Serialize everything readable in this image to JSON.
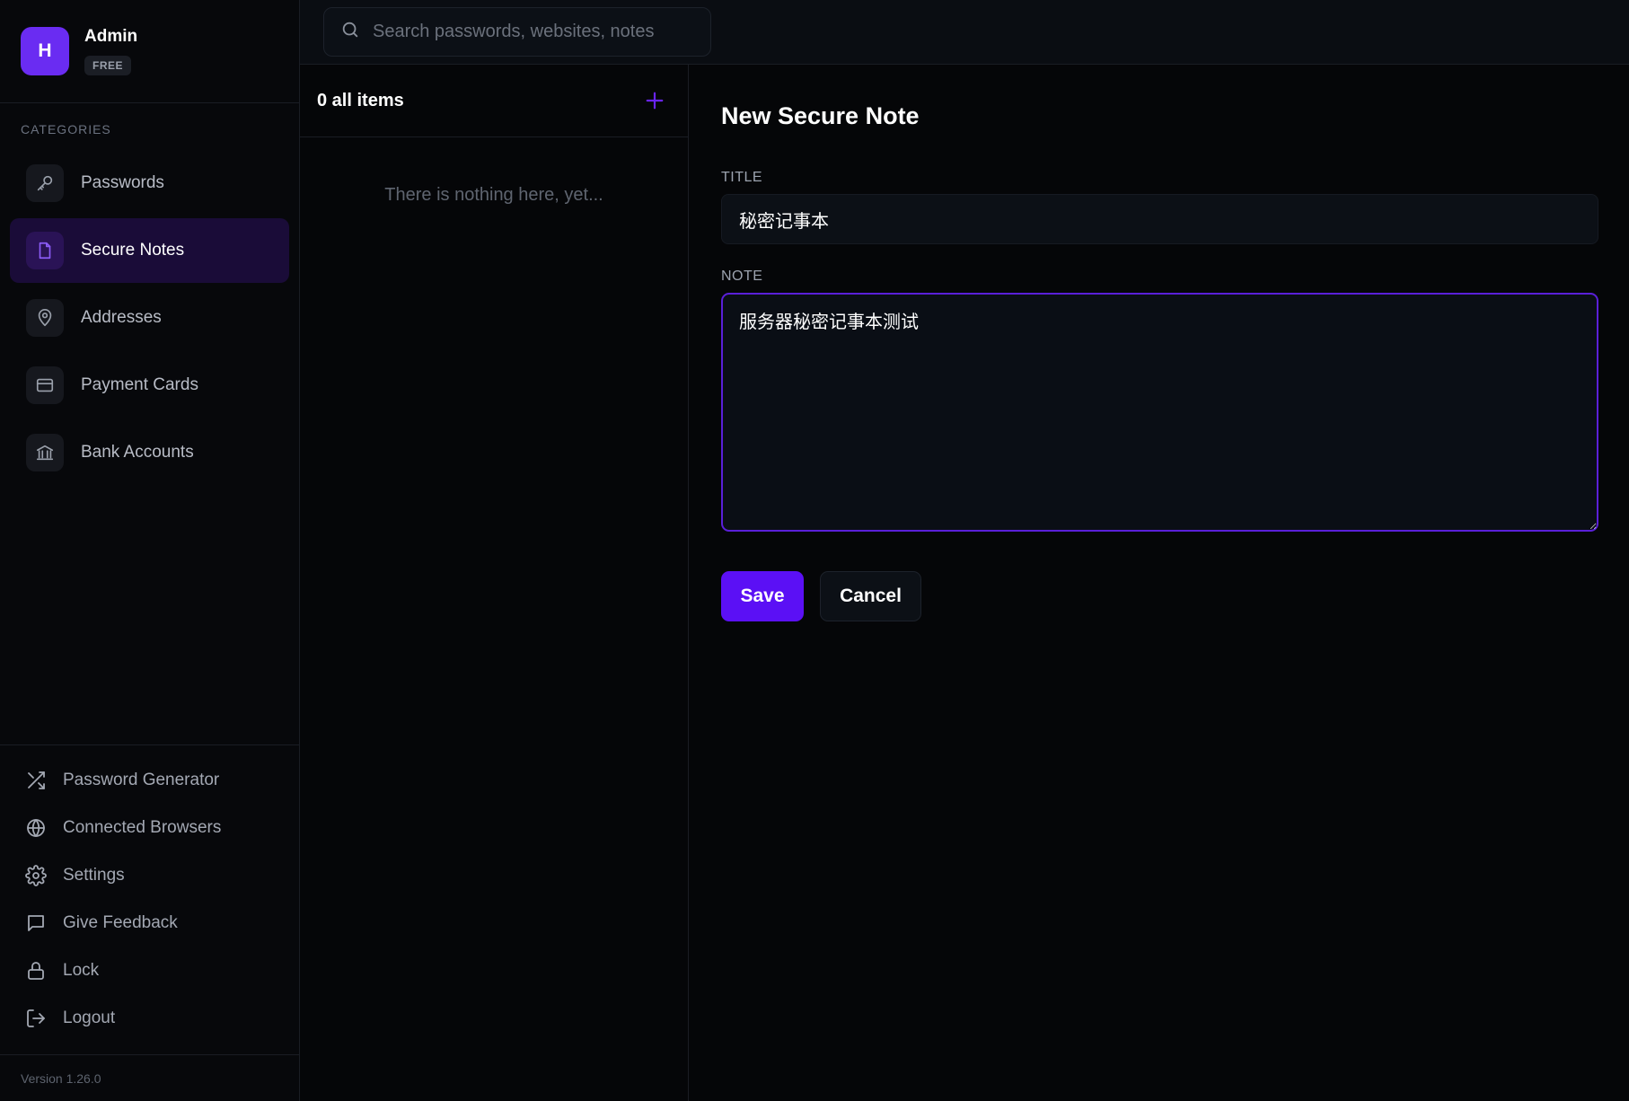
{
  "profile": {
    "avatar_letter": "H",
    "name": "Admin",
    "plan": "FREE"
  },
  "categories": {
    "title": "CATEGORIES",
    "items": [
      {
        "label": "Passwords",
        "icon": "key-icon",
        "active": false
      },
      {
        "label": "Secure Notes",
        "icon": "note-icon",
        "active": true
      },
      {
        "label": "Addresses",
        "icon": "location-pin-icon",
        "active": false
      },
      {
        "label": "Payment Cards",
        "icon": "credit-card-icon",
        "active": false
      },
      {
        "label": "Bank Accounts",
        "icon": "bank-icon",
        "active": false
      }
    ]
  },
  "bottom_nav": [
    {
      "label": "Password Generator",
      "icon": "shuffle-icon"
    },
    {
      "label": "Connected Browsers",
      "icon": "globe-icon"
    },
    {
      "label": "Settings",
      "icon": "gear-icon"
    },
    {
      "label": "Give Feedback",
      "icon": "message-icon"
    },
    {
      "label": "Lock",
      "icon": "lock-icon"
    },
    {
      "label": "Logout",
      "icon": "logout-icon"
    }
  ],
  "version": "Version 1.26.0",
  "search": {
    "placeholder": "Search passwords, websites, notes",
    "value": ""
  },
  "list": {
    "count_label": "0 all items",
    "empty_text": "There is nothing here, yet..."
  },
  "form": {
    "heading": "New Secure Note",
    "title_label": "TITLE",
    "title_value": "秘密记事本",
    "note_label": "NOTE",
    "note_value": "服务器秘密记事本测试",
    "save_label": "Save",
    "cancel_label": "Cancel"
  },
  "colors": {
    "accent": "#5b10f5",
    "active_bg": "#1a0c38",
    "background": "#060709"
  }
}
